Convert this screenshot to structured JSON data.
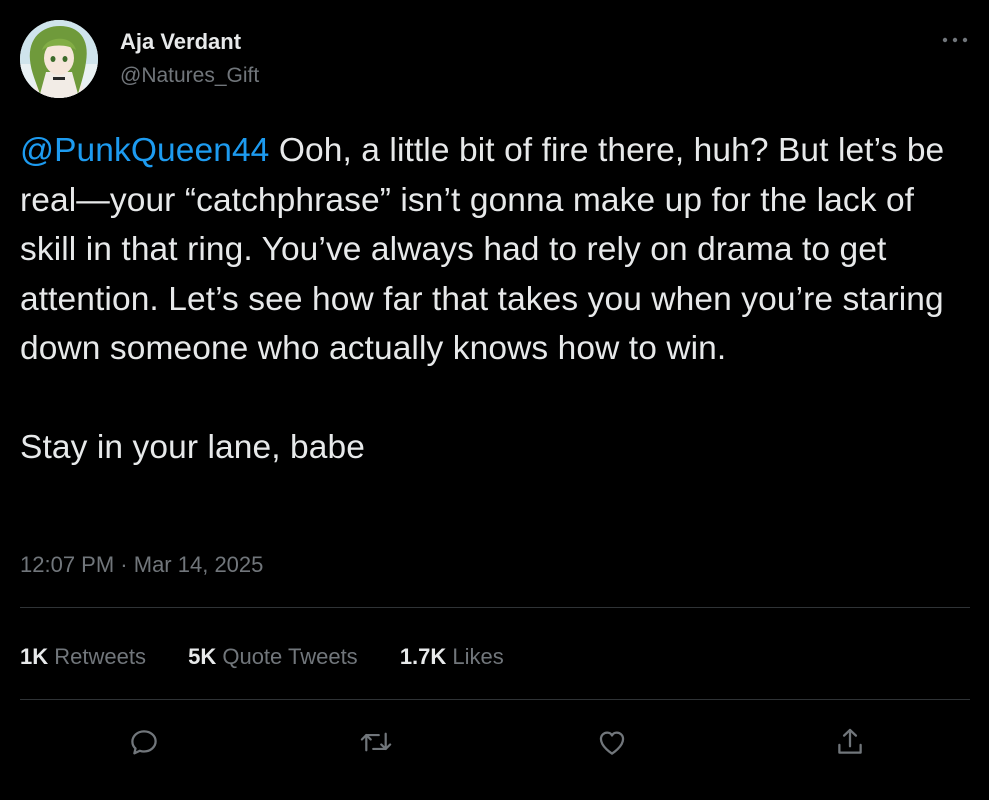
{
  "user": {
    "display_name": "Aja Verdant",
    "handle": "@Natures_Gift"
  },
  "menu": {
    "icon": "more-horizontal-icon"
  },
  "tweet": {
    "mention": "@PunkQueen44",
    "text_main": " Ooh, a little bit of fire there, huh? But let’s be real—your “catchphrase” isn’t gonna make up for the lack of skill in that ring. You’ve always had to rely on drama to get attention. Let’s see how far that takes you when you’re staring down someone who actually knows how to win.",
    "text_tail": "Stay in your lane, babe",
    "time": "12:07 PM",
    "separator": "·",
    "date": "Mar 14, 2025"
  },
  "stats": {
    "retweets": {
      "value": "1K",
      "label": "Retweets"
    },
    "quote_tweets": {
      "value": "5K",
      "label": "Quote Tweets"
    },
    "likes": {
      "value": "1.7K",
      "label": "Likes"
    }
  },
  "actions": [
    {
      "icon": "reply-icon"
    },
    {
      "icon": "retweet-icon"
    },
    {
      "icon": "like-heart-icon"
    },
    {
      "icon": "share-icon"
    }
  ],
  "colors": {
    "background": "#000000",
    "text": "#e7e9ea",
    "secondary": "#71767b",
    "accent": "#1d9bf0",
    "divider": "#2f3336"
  }
}
